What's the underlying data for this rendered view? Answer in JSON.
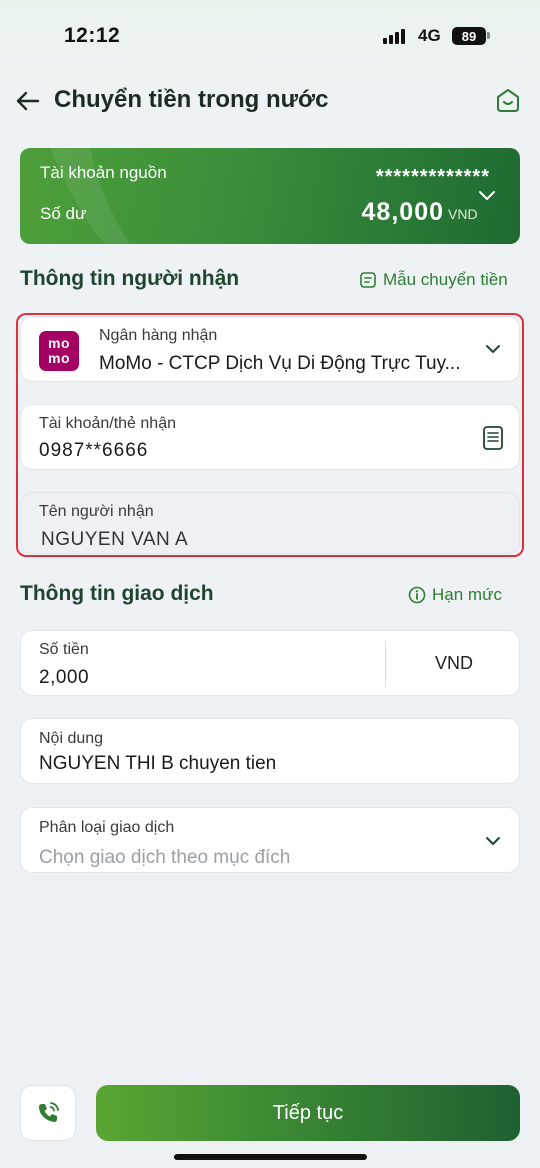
{
  "status_bar": {
    "time": "12:12",
    "network": "4G",
    "battery": "89"
  },
  "header": {
    "title": "Chuyển tiền trong nước",
    "back_icon": "arrow-left-icon",
    "home_icon": "home-icon"
  },
  "source_account": {
    "label": "Tài khoản nguồn",
    "number_masked": "*************",
    "balance_label": "Số dư",
    "balance": "48,000",
    "currency": "VND"
  },
  "recipient_section": {
    "title": "Thông tin người nhận",
    "template_link": "Mẫu chuyển tiền",
    "bank": {
      "label": "Ngân hàng nhận",
      "value": "MoMo - CTCP Dịch Vụ Di Động Trực Tuy...",
      "logo_top": "mo",
      "logo_bottom": "mo"
    },
    "account": {
      "label": "Tài khoản/thẻ nhận",
      "value": "0987**6666"
    },
    "name": {
      "label": "Tên người nhận",
      "value": "NGUYEN VAN A"
    }
  },
  "transaction_section": {
    "title": "Thông tin giao dịch",
    "limit_link": "Hạn mức",
    "amount": {
      "label": "Số tiền",
      "value": "2,000",
      "currency": "VND"
    },
    "content": {
      "label": "Nội dung",
      "value": "NGUYEN THI B chuyen tien"
    },
    "category": {
      "label": "Phân loại giao dịch",
      "placeholder": "Chọn giao dịch theo mục đích"
    }
  },
  "footer": {
    "continue_label": "Tiếp tục",
    "call_icon": "phone-icon"
  },
  "colors": {
    "brand_green": "#2e7d32",
    "highlight_red": "#e0303f",
    "momo": "#a50064"
  }
}
